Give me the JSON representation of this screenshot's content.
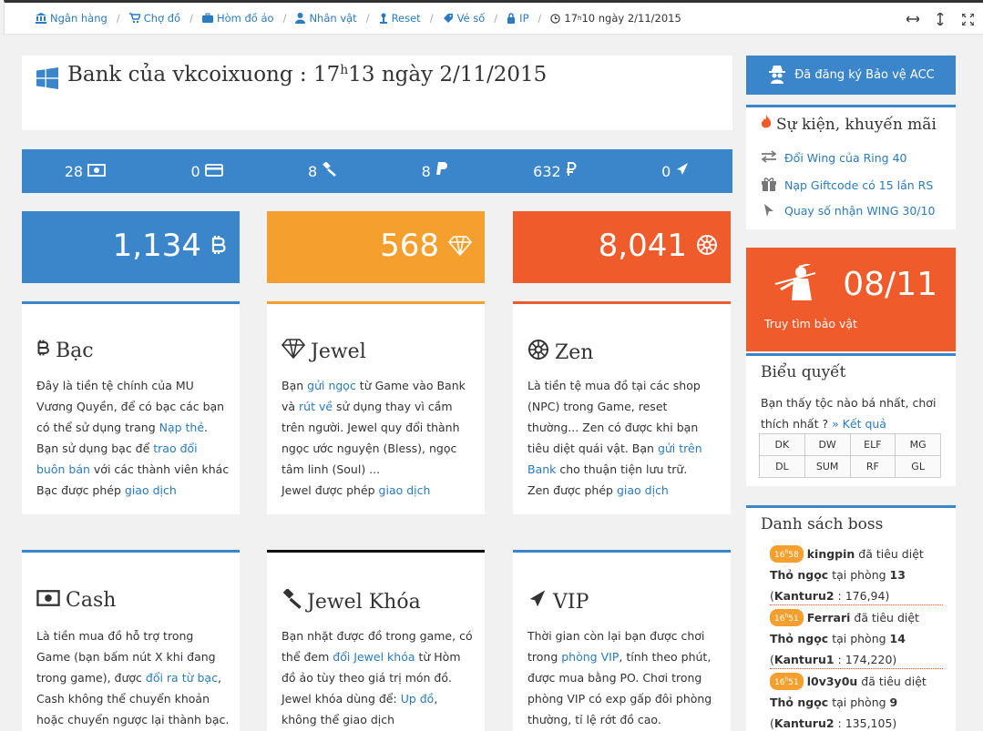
{
  "breadcrumb": {
    "items": [
      {
        "label": "Ngân hàng",
        "icon": "bank-icon"
      },
      {
        "label": "Chợ đồ",
        "icon": "cart-icon"
      },
      {
        "label": "Hòm đồ ảo",
        "icon": "briefcase-icon"
      },
      {
        "label": "Nhân vật",
        "icon": "user-icon"
      },
      {
        "label": "Reset",
        "icon": "reset-icon"
      },
      {
        "label": "Vé số",
        "icon": "ticket-icon"
      },
      {
        "label": "IP",
        "icon": "ip-icon"
      }
    ],
    "clock_hour": "17",
    "clock_sup": "h",
    "clock_rest": "10 ngày 2/11/2015"
  },
  "window_controls": [
    "expand-horizontal-icon",
    "expand-vertical-icon",
    "fullscreen-icon"
  ],
  "bank": {
    "title_prefix": "Bank của vkcoixuong : 17",
    "title_sup": "h",
    "title_suffix": "13 ngày 2/11/2015"
  },
  "stats": [
    {
      "value": "28",
      "icon": "money-icon"
    },
    {
      "value": "0",
      "icon": "credit-card-icon"
    },
    {
      "value": "8",
      "icon": "gavel-icon"
    },
    {
      "value": "8",
      "icon": "paypal-icon"
    },
    {
      "value": "632",
      "icon": "ruble-icon"
    },
    {
      "value": "0",
      "icon": "plane-icon"
    }
  ],
  "balances": [
    {
      "value": "1,134",
      "icon": "bitcoin-icon",
      "color": "#3b86cb"
    },
    {
      "value": "568",
      "icon": "diamond-icon",
      "color": "#f5a02e"
    },
    {
      "value": "8,041",
      "icon": "empire-icon",
      "color": "#f05b2b"
    }
  ],
  "cards": {
    "bac": {
      "title": "Bạc",
      "p1": "Đây là tiền tệ chính của MU Vương Quyền, để có bạc các bạn có thể sử dụng trang ",
      "link1": "Nạp thẻ",
      "p2": ". Bạn sử dụng bạc để ",
      "link2": "trao đổi buôn bán",
      "p3": " với các thành viên khác",
      "p4": "Bạc được phép ",
      "link3": "giao dịch"
    },
    "jewel": {
      "title": "Jewel",
      "p1": "Bạn ",
      "link1": "gửi ngọc",
      "p2": " từ Game vào Bank và ",
      "link2": "rút về",
      "p3": " sử dụng thay vì cầm trên người. Jewel quy đổi thành ngọc ước nguyện (Bless), ngọc tâm linh (Soul) ...",
      "p4": "Jewel được phép ",
      "link3": "giao dịch"
    },
    "zen": {
      "title": "Zen",
      "p1": "Là tiền tệ mua đồ tại các shop (NPC) trong Game, reset thường... Zen có được khi bạn tiêu diệt quái vật. Bạn ",
      "link1": "gửi trên Bank",
      "p2": " cho thuận tiện lưu trữ.",
      "p4": "Zen được phép ",
      "link3": "giao dịch"
    },
    "cash": {
      "title": "Cash",
      "p1": "Là tiền mua đồ hỗ trợ trong Game (bạn bấm nút X khi đang trong game), được ",
      "link1": "đổi ra từ bạc",
      "p2": ", Cash không thể chuyển khoản hoặc chuyển ngược lại thành bạc."
    },
    "jewel_lock": {
      "title": "Jewel Khóa",
      "p1": "Bạn nhặt được đồ trong game, có thể đem ",
      "link1": "đổi Jewel khóa",
      "p2": " từ Hòm đồ ảo tùy theo giá trị món đồ. Jewel khóa dùng để: ",
      "link2": "Up đồ",
      "p3": ", không thể giao dịch"
    },
    "vip": {
      "title": "VIP",
      "p1": "Thời gian còn lại bạn được chơi trong ",
      "link1": "phòng VIP",
      "p2": ", tính theo phút, được mua bằng PO. Chơi trong phòng VIP có exp gấp đôi phòng thường, tỉ lệ rớt đồ cao."
    }
  },
  "sidebar": {
    "protect_button": "Đã đăng ký Bảo vệ ACC",
    "events": {
      "title": "Sự kiện, khuyến mãi",
      "items": [
        {
          "label": "Đổi Wing của Ring 40",
          "icon": "exchange-icon"
        },
        {
          "label": "Nạp Giftcode có 15 lần RS",
          "icon": "gift-icon"
        },
        {
          "label": "Quay số nhận WING 30/10",
          "icon": "cursor-icon"
        }
      ]
    },
    "treasure": {
      "date": "08/11",
      "label": "Truy tìm bảo vật"
    },
    "poll": {
      "title": "Biểu quyết",
      "question": "Bạn thấy tộc nào bá nhất, chơi thích nhất ? ",
      "result_link": "» Kết quả",
      "options": [
        "DK",
        "DW",
        "ELF",
        "MG",
        "DL",
        "SUM",
        "RF",
        "GL"
      ]
    },
    "boss": {
      "title": "Danh sách boss",
      "entries": [
        {
          "time_h": "16",
          "time_sup": "h",
          "time_m": "58",
          "player": "kingpin",
          "action": " đã tiêu diệt ",
          "boss": "Thỏ ngọc",
          "room_text": " tại phòng ",
          "room": "13",
          "map": "Kanturu2",
          "coords": " : 176,94)"
        },
        {
          "time_h": "16",
          "time_sup": "h",
          "time_m": "51",
          "player": "Ferrari",
          "action": " đã tiêu diệt ",
          "boss": "Thỏ ngọc",
          "room_text": " tại phòng ",
          "room": "14",
          "map": "Kanturu1",
          "coords": " : 174,220)"
        },
        {
          "time_h": "16",
          "time_sup": "h",
          "time_m": "51",
          "player": "l0v3y0u",
          "action": " đã tiêu diệt ",
          "boss": "Thỏ ngọc",
          "room_text": " tại phòng ",
          "room": "9",
          "map": "Kanturu2",
          "coords": " : 135,105)"
        }
      ]
    }
  }
}
